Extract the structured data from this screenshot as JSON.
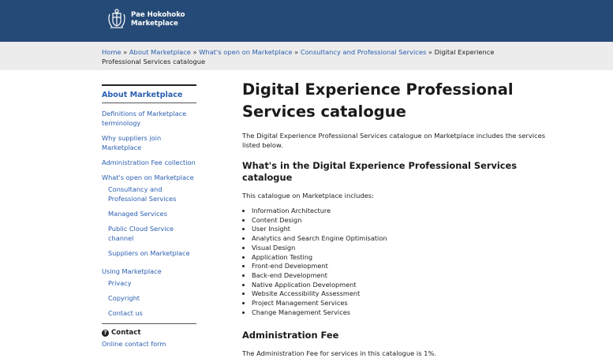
{
  "header": {
    "brand_line1": "Pae Hokohoko",
    "brand_line2": "Marketplace"
  },
  "breadcrumb": [
    "Home",
    "About Marketplace",
    "What's open on Marketplace",
    "Consultancy and Professional Services",
    "Digital Experience Professional Services catalogue"
  ],
  "breadcrumb_separator": "»",
  "sidebar": {
    "title": "About Marketplace",
    "items": [
      "Definitions of Marketplace terminology",
      "Why suppliers join Marketplace",
      "Administration Fee collection",
      "What's open on Marketplace"
    ],
    "sub_items": [
      "Consultancy and Professional Services",
      "Managed Services",
      "Public Cloud Service channel",
      "Suppliers on Marketplace"
    ],
    "using_title": "Using Marketplace",
    "using_items": [
      "Privacy",
      "Copyright",
      "Contact us"
    ],
    "contact_heading": "Contact",
    "contact_link": "Online contact form"
  },
  "main": {
    "title": "Digital Experience Professional Services catalogue",
    "intro": "The Digital Experience Professional Services catalogue on Marketplace includes the services listed below.",
    "section1_heading": "What's in the Digital Experience Professional Services catalogue",
    "section1_intro": "This catalogue on Marketplace includes:",
    "services": [
      "Information Architecture",
      "Content Design",
      "User Insight",
      "Analytics and Search Engine Optimisation",
      "Visual Design",
      "Application Testing",
      "Front-end Development",
      "Back-end Development",
      "Native Application Development",
      "Website Accessibility Assessment",
      "Project Management Services",
      "Change Management Services"
    ],
    "section2_heading": "Administration Fee",
    "section2_text": "The Administration Fee for services in this catalogue is 1%."
  },
  "colors": {
    "header_bg": "#264a77",
    "link": "#2b5fb0",
    "crumb_bg": "#ececec"
  }
}
